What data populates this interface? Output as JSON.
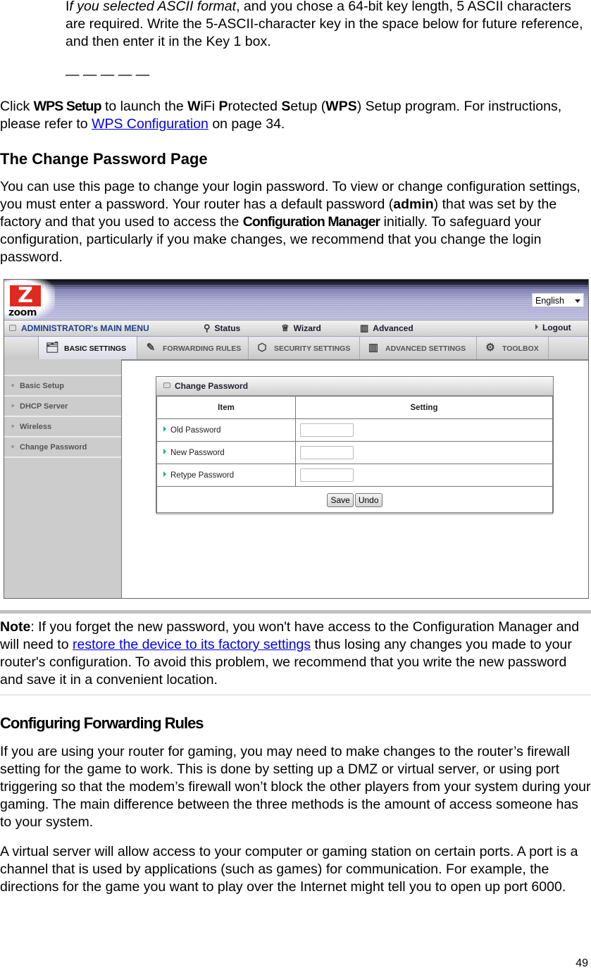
{
  "intro": {
    "ascii_para": {
      "italic_lead_I": "I",
      "italic_phrase": "f you selected ASCII format",
      "rest": ", and you chose a 64-bit key length, 5 ASCII characters are required. Write the 5-ASCII-character key in the space below for future reference, and then enter it in the Key 1 box."
    },
    "key_blanks": "— — — — —",
    "wps_para": {
      "t1": "Click ",
      "wps_setup": "WPS Setup",
      "t2": " to launch the ",
      "w": "W",
      "t3": "iFi ",
      "p": "P",
      "t4": "rotected ",
      "s": "S",
      "t5": "etup (",
      "wps": "WPS",
      "t6": ") Setup program. For instructions, please refer to ",
      "link": "WPS Configuration",
      "t7": " on page 34."
    }
  },
  "change_password_section": {
    "heading": "The Change Password Page",
    "para": {
      "t1": "You can use this page to change your login password. To view or change configuration settings, you must enter a password. Your router has a default password (",
      "admin": "admin",
      "t2": ") that was set by the factory and that you used to access the ",
      "config_manager": "Configuration Manager",
      "t3": " initially. To safeguard your configuration, particularly if you make changes, we recommend that you change the login password."
    }
  },
  "router_ui": {
    "brand": {
      "logo_letter": "Z",
      "logo_word": "zoom"
    },
    "language_select": {
      "value": "English"
    },
    "main_menu": {
      "title": "ADMINISTRATOR's MAIN MENU",
      "items": [
        {
          "label": "Status",
          "icon": "status-person-icon"
        },
        {
          "label": "Wizard",
          "icon": "wizard-icon"
        },
        {
          "label": "Advanced",
          "icon": "advanced-book-icon"
        }
      ],
      "logout": "Logout"
    },
    "tabs": [
      {
        "label": "BASIC SETTINGS",
        "icon": "folder-icon",
        "active": true
      },
      {
        "label": "FORWARDING RULES",
        "icon": "forwarding-icon",
        "active": false
      },
      {
        "label": "SECURITY SETTINGS",
        "icon": "nut-icon",
        "active": false
      },
      {
        "label": "ADVANCED SETTINGS",
        "icon": "book-icon",
        "active": false
      },
      {
        "label": "TOOLBOX",
        "icon": "toolbox-icon",
        "active": false
      }
    ],
    "sidebar": [
      {
        "label": "Basic Setup"
      },
      {
        "label": "DHCP Server"
      },
      {
        "label": "Wireless"
      },
      {
        "label": "Change Password"
      }
    ],
    "panel": {
      "title": "Change Password",
      "col_item": "Item",
      "col_setting": "Setting",
      "rows": [
        {
          "label": "Old Password",
          "value": ""
        },
        {
          "label": "New Password",
          "value": ""
        },
        {
          "label": "Retype Password",
          "value": ""
        }
      ],
      "save": "Save",
      "undo": "Undo"
    }
  },
  "note": {
    "label": "Note",
    "t1": ": If you forget the new password, you won't have access to the Configuration Manager and will need to ",
    "link": "restore the device to its factory settings",
    "t2": " thus losing any changes you made to your router's configuration. To avoid this problem, we recommend that you write the new password and save it in a convenient location."
  },
  "forwarding_section": {
    "heading": "Configuring Forwarding Rules",
    "para1": "If you are using your router for gaming, you may need to make changes to the router’s firewall setting for the game to work. This is done by setting up a DMZ or virtual server, or using port triggering so that the modem’s firewall won’t block the other players from your system during your gaming. The main difference between the three methods is the amount of access someone has to your system.",
    "para2": "A virtual server will allow access to your computer or gaming station on certain ports. A port is a channel that is used by applications (such as games) for communication. For example, the directions for the game you want to play over the Internet might tell you to open up port 6000."
  },
  "page_number": "49",
  "colors": {
    "link": "#0000ee",
    "logo_red": "#e02a1f",
    "menu_title": "#1d3f8a",
    "sidebar_bg": "#cccccc"
  }
}
